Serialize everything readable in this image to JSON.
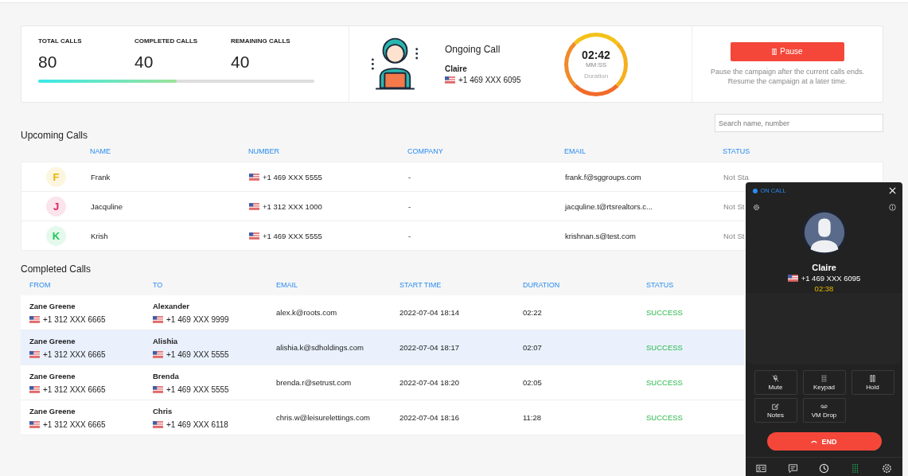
{
  "stats": [
    {
      "label": "TOTAL CALLS",
      "value": "80"
    },
    {
      "label": "COMPLETED CALLS",
      "value": "40"
    },
    {
      "label": "REMAINING CALLS",
      "value": "40"
    }
  ],
  "progress": {
    "level": 0.5
  },
  "ongoing": {
    "title": "Ongoing Call",
    "name": "Claire",
    "number": "+1 469 XXX 6095",
    "timer": "02:42",
    "unit": "MM:SS",
    "caption": "Duration"
  },
  "pause": {
    "label": "Pause",
    "note": "Pause the campaign after the current calls ends. Resume the campaign at a later time."
  },
  "search": {
    "placeholder": "Search name, number"
  },
  "upcoming": {
    "title": "Upcoming Calls",
    "columns": [
      "NAME",
      "NUMBER",
      "COMPANY",
      "EMAIL",
      "STATUS"
    ],
    "rows": [
      {
        "initial": "F",
        "color": "#e8b400",
        "name": "Frank",
        "number": "+1 469 XXX 5555",
        "company": "-",
        "email": "frank.f@sggroups.com",
        "status": "Not Sta"
      },
      {
        "initial": "J",
        "color": "#e0245e",
        "name": "Jacquline",
        "number": "+1 312 XXX 1000",
        "company": "-",
        "email": "jacquline.t@rtsrealtors.c...",
        "status": "Not St"
      },
      {
        "initial": "K",
        "color": "#22c55e",
        "name": "Krish",
        "number": "+1 469 XXX 5555",
        "company": "-",
        "email": "krishnan.s@test.com",
        "status": "Not St"
      }
    ]
  },
  "completed": {
    "title": "Completed Calls",
    "columns": [
      "FROM",
      "TO",
      "EMAIL",
      "START TIME",
      "DURATION",
      "STATUS"
    ],
    "rows": [
      {
        "from": "Zane Greene",
        "from_number": "+1 312 XXX 6665",
        "to": "Alexander",
        "to_number": "+1 469 XXX 9999",
        "email": "alex.k@roots.com",
        "start": "2022-07-04 18:14",
        "duration": "02:22",
        "status": "SUCCESS",
        "selected": false
      },
      {
        "from": "Zane Greene",
        "from_number": "+1 312 XXX 6665",
        "to": "Alishia",
        "to_number": "+1 469 XXX 5555",
        "email": "alishia.k@sdholdings.com",
        "start": "2022-07-04 18:17",
        "duration": "02:07",
        "status": "SUCCESS",
        "selected": true
      },
      {
        "from": "Zane Greene",
        "from_number": "+1 312 XXX 6665",
        "to": "Brenda",
        "to_number": "+1 469 XXX 5555",
        "email": "brenda.r@setrust.com",
        "start": "2022-07-04 18:20",
        "duration": "02:05",
        "status": "SUCCESS",
        "selected": false
      },
      {
        "from": "Zane Greene",
        "from_number": "+1 312 XXX 6665",
        "to": "Chris",
        "to_number": "+1 469 XXX 6118",
        "email": "chris.w@leisurelettings.com",
        "start": "2022-07-04 18:16",
        "duration": "11:28",
        "status": "SUCCESS",
        "selected": false
      }
    ]
  },
  "phone": {
    "status": "ON CALL",
    "name": "Claire",
    "number": "+1 469 XXX 6095",
    "timer": "02:38",
    "actions": [
      {
        "kind": "mute",
        "label": "Mute"
      },
      {
        "kind": "keypad",
        "label": "Keypad"
      },
      {
        "kind": "hold",
        "label": "Hold"
      },
      {
        "kind": "notes",
        "label": "Notes"
      },
      {
        "kind": "vmdrop",
        "label": "VM Drop"
      }
    ],
    "end": "END",
    "nav": [
      {
        "kind": "contacts",
        "selected": false
      },
      {
        "kind": "messages",
        "selected": false
      },
      {
        "kind": "history",
        "selected": false
      },
      {
        "kind": "dialpad",
        "selected": true
      },
      {
        "kind": "settings",
        "selected": false
      }
    ]
  }
}
